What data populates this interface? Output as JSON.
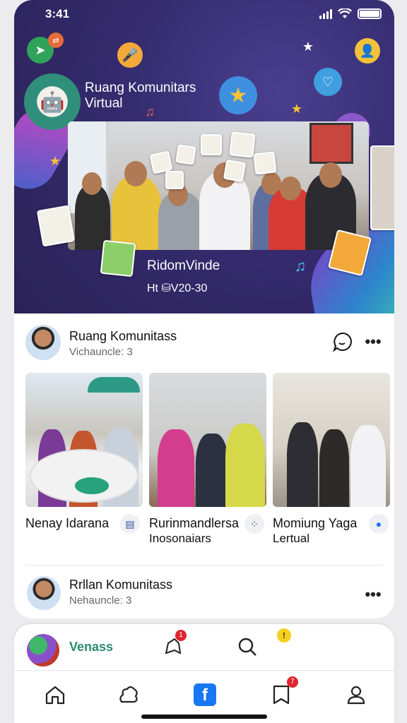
{
  "status_bar": {
    "time": "3:41"
  },
  "hero": {
    "title_line1": "Ruang Komunitars",
    "title_line2": "Virtual",
    "subtitle": "RidomVinde",
    "meta": "Ht ⛁V20-30"
  },
  "post": {
    "author": "Ruang Komunitass",
    "subtitle": "Vichauncle: 3",
    "tiles": [
      {
        "caption_line1": "Nenay Idarana",
        "caption_line2": "",
        "icon": "save-icon"
      },
      {
        "caption_line1": "Rurinmandlersa",
        "caption_line2": "Inosonaiars",
        "icon": "dots-icon"
      },
      {
        "caption_line1": "Momiung Yaga",
        "caption_line2": "Lertual",
        "icon": "chat-icon"
      }
    ]
  },
  "post2": {
    "author": "Rrllan Komunitass",
    "subtitle": "Nehauncle: 3"
  },
  "dock": {
    "label": "Venass",
    "notif_badge": "1",
    "nav_badge": "7"
  },
  "colors": {
    "hero_bg": "#352b6e",
    "accent_green": "#2c8a6e",
    "brand_blue": "#1877f2",
    "badge_red": "#e0242e"
  }
}
